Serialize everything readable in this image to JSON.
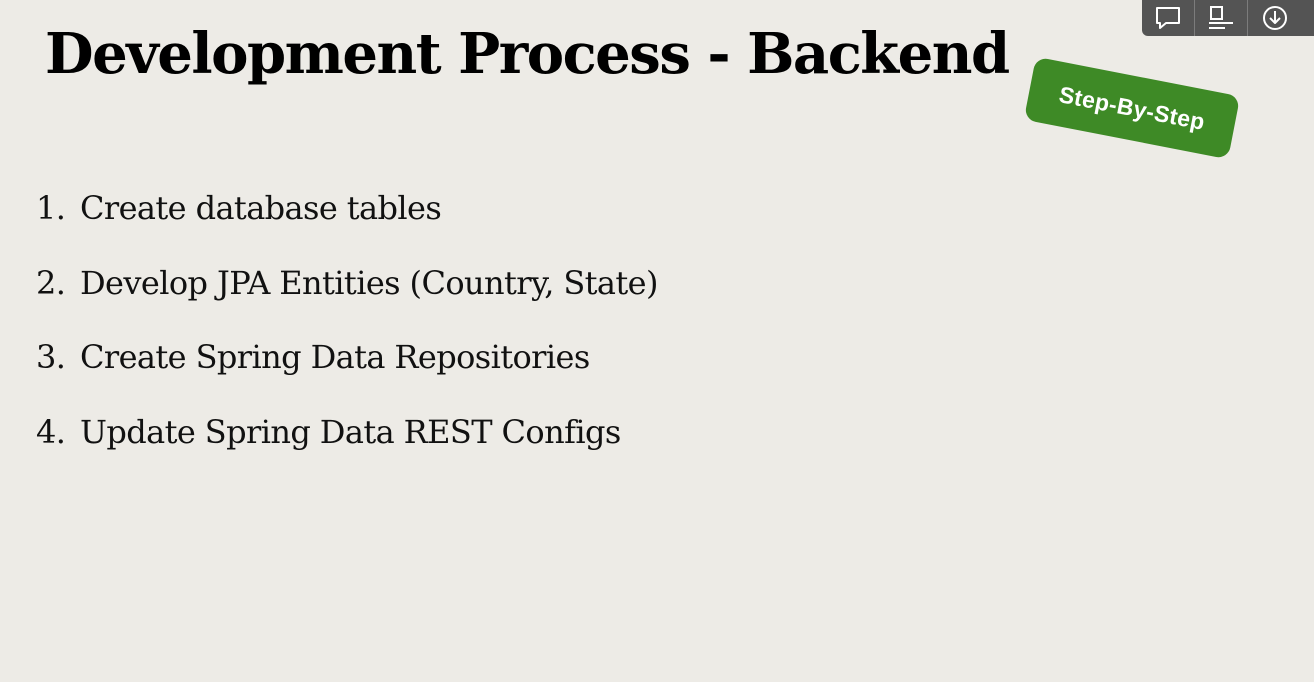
{
  "slide": {
    "title": "Development Process - Backend",
    "badge": "Step-By-Step",
    "steps": [
      {
        "number": "1.",
        "text": "Create database tables"
      },
      {
        "number": "2.",
        "text": "Develop JPA Entities (Country, State)"
      },
      {
        "number": "3.",
        "text": "Create Spring Data Repositories"
      },
      {
        "number": "4.",
        "text": "Update Spring Data REST Configs"
      }
    ]
  },
  "toolbar": {
    "icons": [
      "comment-icon",
      "notes-icon",
      "download-icon"
    ]
  },
  "colors": {
    "background": "#edebe6",
    "badge": "#3e8a26",
    "toolbar": "#545454"
  }
}
